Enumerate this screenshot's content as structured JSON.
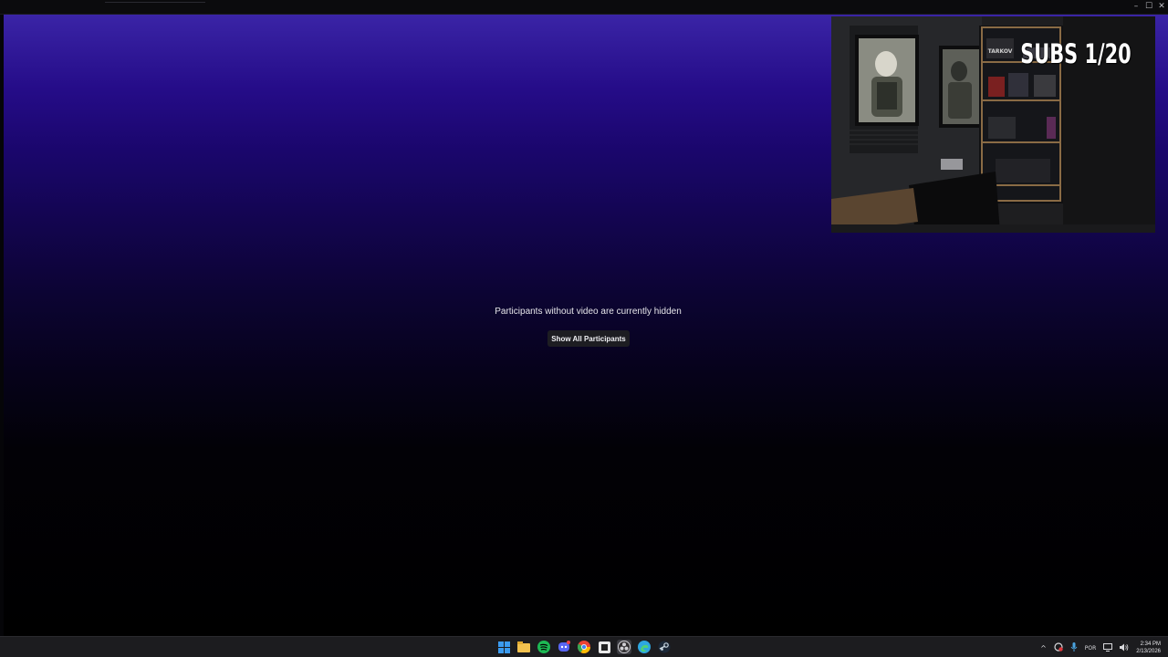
{
  "window": {
    "controls": {
      "minimize": "–",
      "maximize": "☐",
      "close": "✕"
    }
  },
  "stage": {
    "hidden_message": "Participants without video are currently hidden",
    "show_all_label": "Show All Participants",
    "gradient_top_color": "#3a24a6",
    "gradient_bottom_color": "#000000"
  },
  "webcam": {
    "overlay_text": "SUBS 1/20",
    "poster_brand": "TARKOV"
  },
  "taskbar": {
    "apps": [
      {
        "name": "windows-start-icon",
        "color": "#3b9bf0"
      },
      {
        "name": "file-explorer-icon",
        "color": "#f2c14e"
      },
      {
        "name": "spotify-icon",
        "color": "#1db954"
      },
      {
        "name": "discord-icon",
        "color": "#5865f2"
      },
      {
        "name": "chrome-icon",
        "color": "#fbbc04"
      },
      {
        "name": "app-icon",
        "color": "#e8e8e8"
      },
      {
        "name": "obs-icon",
        "color": "#cfcfd4"
      },
      {
        "name": "edge-icon",
        "color": "#2ea7e0"
      },
      {
        "name": "steam-icon",
        "color": "#c7d5e0"
      }
    ],
    "tray": {
      "chevron": "^",
      "language": "POR",
      "time": "2:34 PM",
      "date": "2/13/2026"
    }
  }
}
